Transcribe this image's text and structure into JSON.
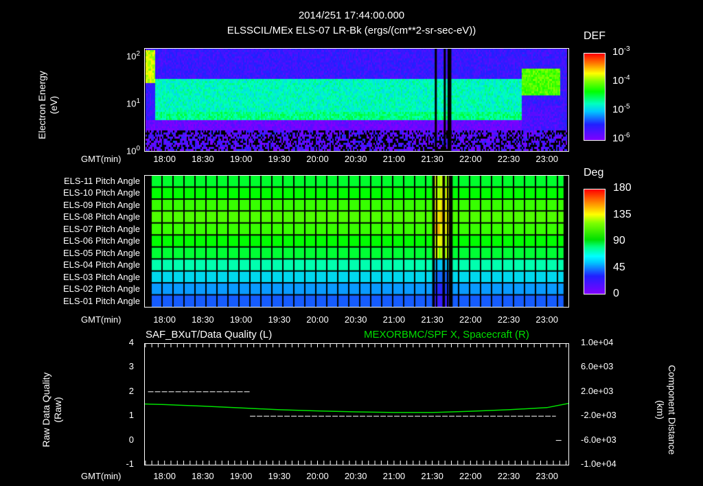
{
  "header": {
    "timestamp": "2014/251 17:44:00.000",
    "subtitle": "ELSSCIL/MEx ELS-07 LR-Bk  (ergs/(cm**2-sr-sec-eV))"
  },
  "time_axis": {
    "label": "GMT(min)",
    "ticks": [
      "18:00",
      "18:30",
      "19:00",
      "19:30",
      "20:00",
      "20:30",
      "21:00",
      "21:30",
      "22:00",
      "22:30",
      "23:00"
    ],
    "start": "17:44",
    "end": "23:17"
  },
  "chart_data": [
    {
      "type": "heatmap",
      "title": "ELSSCIL/MEx ELS-07 LR-Bk  (ergs/(cm**2-sr-sec-eV))",
      "ylabel": "Electron Energy",
      "yunit": "(eV)",
      "yscale": "log",
      "ylim": [
        1,
        144
      ],
      "yticks": [
        {
          "base": "10",
          "exp": "2",
          "value": 100
        },
        {
          "base": "10",
          "exp": "1",
          "value": 10
        },
        {
          "base": "10",
          "exp": "0",
          "value": 1
        }
      ],
      "colorbar": {
        "label": "DEF",
        "scale": "log",
        "range": [
          1e-06,
          0.001
        ],
        "ticks": [
          {
            "base": "10",
            "exp": "-3"
          },
          {
            "base": "10",
            "exp": "-4"
          },
          {
            "base": "10",
            "exp": "-5"
          },
          {
            "base": "10",
            "exp": "-6"
          }
        ]
      },
      "features": [
        {
          "desc_range_time": [
            "17:44",
            "17:52"
          ],
          "energy_eV": [
            30,
            144
          ],
          "log_def": -3.8
        },
        {
          "desc_range_time": [
            "17:52",
            "22:40"
          ],
          "energy_eV": [
            4.5,
            7
          ],
          "log_def": -4.6
        },
        {
          "desc_range_time": [
            "17:52",
            "22:40"
          ],
          "energy_eV": [
            7,
            35
          ],
          "log_def": -4.75
        },
        {
          "desc_range_time": [
            "17:52",
            "22:40"
          ],
          "energy_eV": [
            35,
            144
          ],
          "log_def": -5.6
        },
        {
          "desc_range_time": [
            "22:40",
            "23:10"
          ],
          "energy_eV": [
            15,
            60
          ],
          "log_def": -4.1
        },
        {
          "desc_range_time": [
            "22:40",
            "23:10"
          ],
          "energy_eV": [
            1,
            10
          ],
          "log_def": -5.7
        }
      ],
      "data_gaps": [
        [
          "21:32",
          "21:33"
        ],
        [
          "21:39",
          "21:40"
        ],
        [
          "21:42",
          "21:45"
        ]
      ]
    },
    {
      "type": "heatmap",
      "colorbar": {
        "label": "Deg",
        "range": [
          0,
          180
        ],
        "ticks": [
          "180",
          "135",
          "90",
          "45",
          "0"
        ]
      },
      "rows": [
        {
          "label": "ELS-11 Pitch Angle",
          "value": 95
        },
        {
          "label": "ELS-10 Pitch Angle",
          "value": 101
        },
        {
          "label": "ELS-09 Pitch Angle",
          "value": 110
        },
        {
          "label": "ELS-08 Pitch Angle",
          "value": 114
        },
        {
          "label": "ELS-07 Pitch Angle",
          "value": 110
        },
        {
          "label": "ELS-06 Pitch Angle",
          "value": 101
        },
        {
          "label": "ELS-05 Pitch Angle",
          "value": 94
        },
        {
          "label": "ELS-04 Pitch Angle",
          "value": 78
        },
        {
          "label": "ELS-03 Pitch Angle",
          "value": 64
        },
        {
          "label": "ELS-02 Pitch Angle",
          "value": 52
        },
        {
          "label": "ELS-01 Pitch Angle",
          "value": 42
        }
      ],
      "data_gaps": [
        [
          "21:30",
          "21:32"
        ],
        [
          "21:38",
          "21:40"
        ],
        [
          "21:43",
          "21:46"
        ],
        [
          "23:13",
          "23:17"
        ]
      ]
    },
    {
      "type": "line",
      "title_left": "SAF_BXuT/Data Quality (L)",
      "title_right": "MEXORBMC/SPF X, Spacecraft (R)",
      "ylabel_left": "Raw Data Quality",
      "yunit_left": "(Raw)",
      "ylabel_right": "Component Distance",
      "yunit_right": "(km)",
      "ylim_left": [
        -1,
        4
      ],
      "yticks_left": [
        "4",
        "3",
        "2",
        "1",
        "0",
        "-1"
      ],
      "ylim_right": [
        -10000,
        10000
      ],
      "yticks_right": [
        "1.0e+04",
        "6.0e+03",
        "2.0e+03",
        "-2.0e+03",
        "-6.0e+03",
        "-1.0e+04"
      ],
      "series": [
        {
          "name": "Data Quality",
          "color": "#ffffff",
          "axis": "left",
          "segments": [
            {
              "start": "17:47",
              "end": "19:07",
              "value": 2
            },
            {
              "start": "19:07",
              "end": "23:07",
              "value": 1
            },
            {
              "start": "23:07",
              "end": "23:12",
              "value": 0
            }
          ]
        },
        {
          "name": "SPF X",
          "color": "#00e000",
          "axis": "right",
          "x": [
            "17:44",
            "18:00",
            "18:30",
            "19:00",
            "19:30",
            "20:00",
            "20:30",
            "21:00",
            "21:30",
            "22:00",
            "22:30",
            "23:00",
            "23:17"
          ],
          "y": [
            0,
            -100,
            -350,
            -650,
            -950,
            -1150,
            -1300,
            -1400,
            -1400,
            -1200,
            -950,
            -600,
            100
          ]
        }
      ]
    }
  ]
}
